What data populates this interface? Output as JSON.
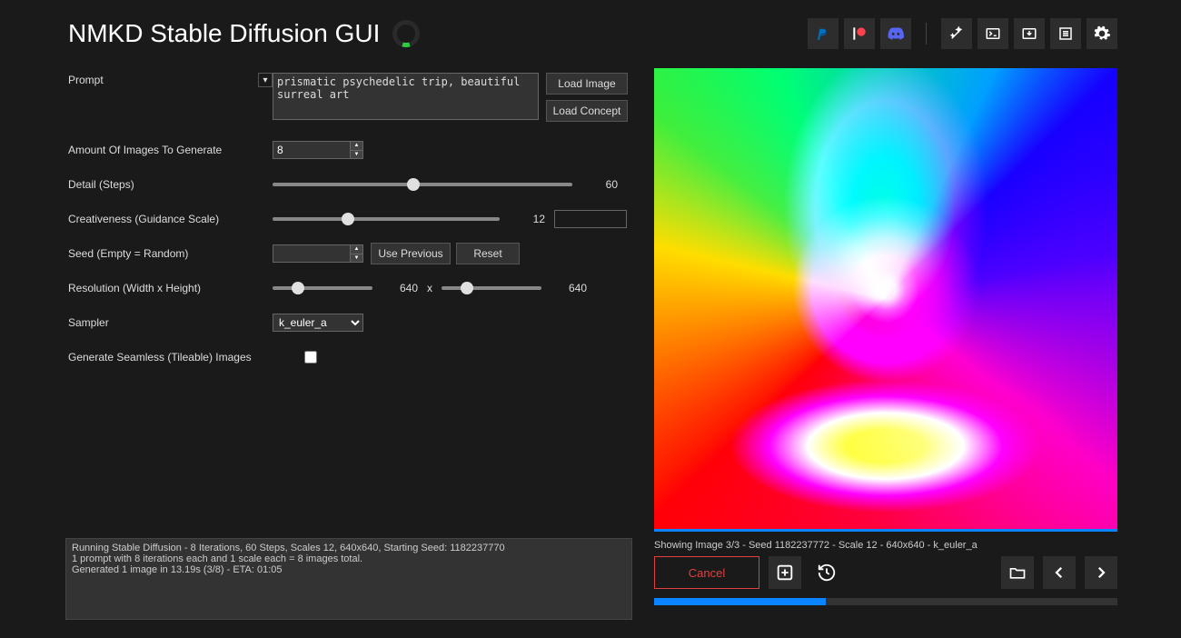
{
  "app": {
    "title": "NMKD Stable Diffusion GUI"
  },
  "prompt": {
    "label": "Prompt",
    "text": "prismatic psychedelic trip, beautiful surreal art",
    "load_image": "Load Image",
    "load_concept": "Load Concept"
  },
  "amount": {
    "label": "Amount Of Images To Generate",
    "value": "8"
  },
  "detail": {
    "label": "Detail (Steps)",
    "value": "60",
    "pct": 47
  },
  "creative": {
    "label": "Creativeness (Guidance Scale)",
    "value": "12",
    "pct": 33
  },
  "seed": {
    "label": "Seed (Empty = Random)",
    "value": "",
    "use_prev": "Use Previous",
    "reset": "Reset"
  },
  "resolution": {
    "label": "Resolution (Width x Height)",
    "width": "640",
    "width_pct": 25,
    "height": "640",
    "height_pct": 25,
    "x": "x"
  },
  "sampler": {
    "label": "Sampler",
    "value": "k_euler_a"
  },
  "seamless": {
    "label": "Generate Seamless (Tileable) Images",
    "checked": false
  },
  "log": {
    "line1": "Running Stable Diffusion - 8 Iterations, 60 Steps, Scales 12, 640x640, Starting Seed: 1182237770",
    "line2": "1 prompt with 8 iterations each and 1 scale each = 8 images total.",
    "line3": "Generated 1 image in 13.19s (3/8) - ETA: 01:05"
  },
  "info": "Showing Image 3/3 - Seed 1182237772 - Scale 12 - 640x640 - k_euler_a",
  "cancel": "Cancel",
  "progress_pct": 37
}
